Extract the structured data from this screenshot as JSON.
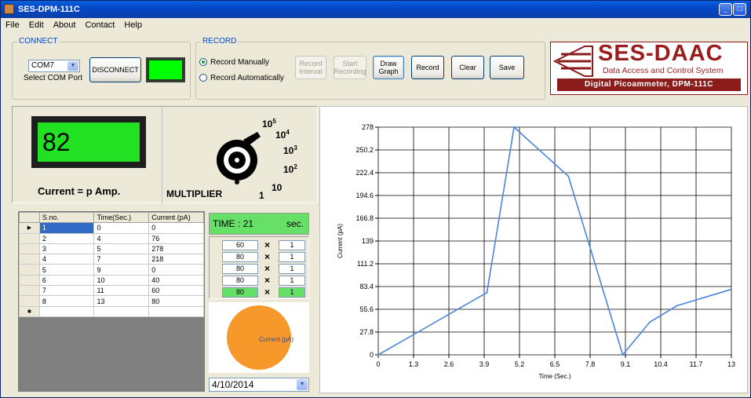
{
  "window": {
    "title": "SES-DPM-111C"
  },
  "menu": [
    "File",
    "Edit",
    "About",
    "Contact",
    "Help"
  ],
  "connect": {
    "group_label": "CONNECT",
    "com_port": "COM7",
    "select_label": "Select COM Port",
    "disconnect_label": "DISCONNECT",
    "status_color": "#00ff00"
  },
  "record": {
    "group_label": "RECORD",
    "manual_label": "Record Manually",
    "auto_label": "Record Automatically",
    "manual_selected": true,
    "buttons": {
      "record_interval": "Record Interval",
      "start_recording": "Start Recording",
      "draw_graph": "Draw Graph",
      "record": "Record",
      "clear": "Clear",
      "save": "Save"
    }
  },
  "logo": {
    "name": "SES-DAAC",
    "tagline": "Data Access and Control System",
    "product": "Digital Picoammeter, DPM-111C"
  },
  "meter": {
    "reading": "82",
    "current_label": "Current =  p Amp.",
    "multiplier_label": "MULTIPLIER",
    "multiplier_marks": [
      "10",
      "10",
      "10",
      "10",
      "10",
      "1"
    ],
    "multiplier_exponents": [
      "5",
      "4",
      "3",
      "2",
      "",
      ""
    ]
  },
  "table": {
    "headers": [
      "S.no.",
      "Time(Sec.)",
      "Current (pA)"
    ],
    "rows": [
      [
        "1",
        "0",
        "0"
      ],
      [
        "2",
        "4",
        "76"
      ],
      [
        "3",
        "5",
        "278"
      ],
      [
        "4",
        "7",
        "218"
      ],
      [
        "5",
        "9",
        "0"
      ],
      [
        "6",
        "10",
        "40"
      ],
      [
        "7",
        "11",
        "60"
      ],
      [
        "8",
        "13",
        "80"
      ]
    ]
  },
  "time_display": {
    "label": "TIME :  21",
    "unit": "sec."
  },
  "multiplier_rows": [
    {
      "value": "60",
      "times": "×",
      "mult": "1"
    },
    {
      "value": "80",
      "times": "×",
      "mult": "1"
    },
    {
      "value": "80",
      "times": "×",
      "mult": "1"
    },
    {
      "value": "80",
      "times": "×",
      "mult": "1"
    },
    {
      "value": "80",
      "times": "×",
      "mult": "1"
    }
  ],
  "pie": {
    "legend": "Current (pA)",
    "color": "#f7982a"
  },
  "date": "4/10/2014",
  "chart_data": {
    "type": "line",
    "xlabel": "Time (Sec.)",
    "ylabel": "Current (pA)",
    "xlim": [
      0,
      13
    ],
    "ylim": [
      0,
      278
    ],
    "xticks": [
      "0",
      "1.3",
      "2.6",
      "3.9",
      "5.2",
      "6.5",
      "7.8",
      "9.1",
      "10.4",
      "11.7",
      "13"
    ],
    "yticks": [
      "0",
      "27.8",
      "55.6",
      "83.4",
      "111.2",
      "139",
      "166.8",
      "194.6",
      "222.4",
      "250.2",
      "278"
    ],
    "grid": true,
    "series": [
      {
        "x": [
          0,
          4,
          5,
          7,
          9,
          10,
          11,
          13
        ],
        "y": [
          0,
          76,
          278,
          218,
          0,
          40,
          60,
          80
        ],
        "color": "#4a86d8"
      }
    ]
  }
}
